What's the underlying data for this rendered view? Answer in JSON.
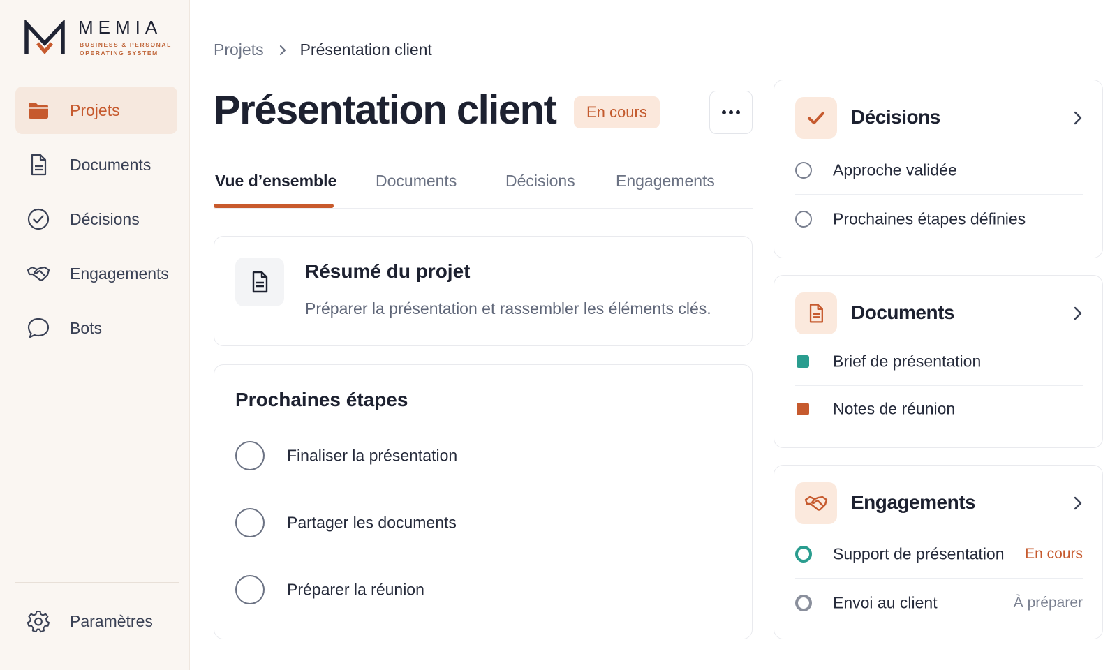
{
  "brand": {
    "name": "MEMIA",
    "tagline": "BUSINESS & PERSONAL OPERATING SYSTEM",
    "accent": "#c65a2e",
    "dark": "#1f2333"
  },
  "sidebar": {
    "items": [
      {
        "label": "Projets",
        "icon": "folder-icon",
        "active": true
      },
      {
        "label": "Documents",
        "icon": "document-icon",
        "active": false
      },
      {
        "label": "Décisions",
        "icon": "check-circle-icon",
        "active": false
      },
      {
        "label": "Engagements",
        "icon": "handshake-icon",
        "active": false
      },
      {
        "label": "Bots",
        "icon": "chat-bubble-icon",
        "active": false
      }
    ],
    "settings": {
      "label": "Paramètres",
      "icon": "gear-icon"
    }
  },
  "breadcrumb": {
    "parent": "Projets",
    "current": "Présentation client"
  },
  "header": {
    "title": "Présentation client",
    "status": "En cours",
    "more_icon": "more-horizontal-icon"
  },
  "tabs": [
    {
      "label": "Vue d’ensemble",
      "active": true
    },
    {
      "label": "Documents",
      "active": false
    },
    {
      "label": "Décisions",
      "active": false
    },
    {
      "label": "Engagements",
      "active": false
    }
  ],
  "summary": {
    "title": "Résumé du projet",
    "description": "Préparer la présentation et rassembler les éléments clés.",
    "icon": "document-icon"
  },
  "next_steps": {
    "title": "Prochaines étapes",
    "items": [
      {
        "label": "Finaliser la présentation",
        "done": false
      },
      {
        "label": "Partager les documents",
        "done": false
      },
      {
        "label": "Préparer la réunion",
        "done": false
      }
    ]
  },
  "decisions_panel": {
    "title": "Décisions",
    "icon": "checkmark-icon",
    "items": [
      {
        "label": "Approche validée"
      },
      {
        "label": "Prochaines étapes définies"
      }
    ]
  },
  "documents_panel": {
    "title": "Documents",
    "icon": "document-icon",
    "items": [
      {
        "label": "Brief de présentation",
        "color": "#2a9d8f"
      },
      {
        "label": "Notes de réunion",
        "color": "#c65a2e"
      }
    ]
  },
  "engagements_panel": {
    "title": "Engagements",
    "icon": "handshake-icon",
    "items": [
      {
        "label": "Support de présentation",
        "status": "En cours",
        "status_color": "#c65a2e",
        "ring": "teal"
      },
      {
        "label": "Envoi au client",
        "status": "À préparer",
        "status_color": "#7a8090",
        "ring": "gray"
      }
    ]
  }
}
